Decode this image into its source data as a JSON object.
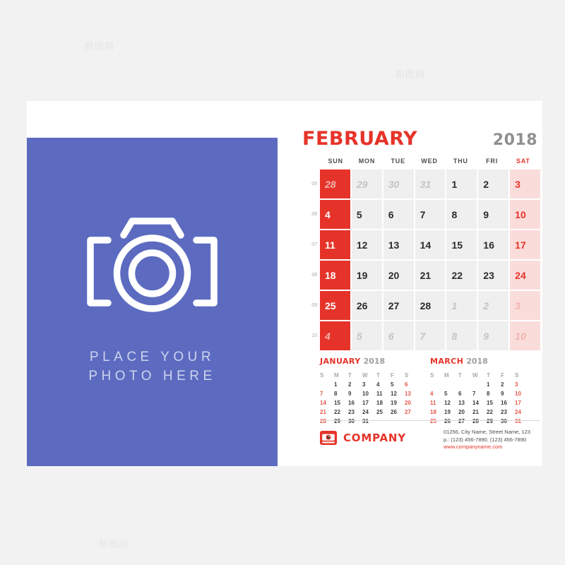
{
  "background_color": "#f2f2f2",
  "accent_red": "#e63329",
  "photo_panel": {
    "background_color": "#5c6bc0",
    "icon": "camera-icon",
    "caption_line1": "PLACE YOUR",
    "caption_line2": "PHOTO HERE"
  },
  "header": {
    "month": "FEBRUARY",
    "year": "2018"
  },
  "weekdays": [
    "SUN",
    "MON",
    "TUE",
    "WED",
    "THU",
    "FRI",
    "SAT"
  ],
  "calendar": {
    "week_numbers": [
      "05",
      "06",
      "07",
      "08",
      "09",
      "10"
    ],
    "weeks": [
      [
        {
          "day": "28",
          "type": "sun out"
        },
        {
          "day": "29",
          "type": "out"
        },
        {
          "day": "30",
          "type": "out"
        },
        {
          "day": "31",
          "type": "out"
        },
        {
          "day": "1",
          "type": ""
        },
        {
          "day": "2",
          "type": ""
        },
        {
          "day": "3",
          "type": "sat"
        }
      ],
      [
        {
          "day": "4",
          "type": "sun"
        },
        {
          "day": "5",
          "type": ""
        },
        {
          "day": "6",
          "type": ""
        },
        {
          "day": "7",
          "type": ""
        },
        {
          "day": "8",
          "type": ""
        },
        {
          "day": "9",
          "type": ""
        },
        {
          "day": "10",
          "type": "sat"
        }
      ],
      [
        {
          "day": "11",
          "type": "sun"
        },
        {
          "day": "12",
          "type": ""
        },
        {
          "day": "13",
          "type": ""
        },
        {
          "day": "14",
          "type": ""
        },
        {
          "day": "15",
          "type": ""
        },
        {
          "day": "16",
          "type": ""
        },
        {
          "day": "17",
          "type": "sat"
        }
      ],
      [
        {
          "day": "18",
          "type": "sun"
        },
        {
          "day": "19",
          "type": ""
        },
        {
          "day": "20",
          "type": ""
        },
        {
          "day": "21",
          "type": ""
        },
        {
          "day": "22",
          "type": ""
        },
        {
          "day": "23",
          "type": ""
        },
        {
          "day": "24",
          "type": "sat"
        }
      ],
      [
        {
          "day": "25",
          "type": "sun"
        },
        {
          "day": "26",
          "type": ""
        },
        {
          "day": "27",
          "type": ""
        },
        {
          "day": "28",
          "type": ""
        },
        {
          "day": "1",
          "type": "out"
        },
        {
          "day": "2",
          "type": "out"
        },
        {
          "day": "3",
          "type": "sat out"
        }
      ],
      [
        {
          "day": "4",
          "type": "sun out"
        },
        {
          "day": "5",
          "type": "out"
        },
        {
          "day": "6",
          "type": "out"
        },
        {
          "day": "7",
          "type": "out"
        },
        {
          "day": "8",
          "type": "out"
        },
        {
          "day": "9",
          "type": "out"
        },
        {
          "day": "10",
          "type": "sat out"
        }
      ]
    ]
  },
  "mini_calendars": [
    {
      "month": "JANUARY",
      "year": "2018",
      "headers": [
        "S",
        "M",
        "T",
        "W",
        "T",
        "F",
        "S"
      ],
      "cells": [
        {
          "day": "",
          "red": false
        },
        {
          "day": "1",
          "red": false
        },
        {
          "day": "2",
          "red": false
        },
        {
          "day": "3",
          "red": false
        },
        {
          "day": "4",
          "red": false
        },
        {
          "day": "5",
          "red": false
        },
        {
          "day": "6",
          "red": true
        },
        {
          "day": "7",
          "red": true
        },
        {
          "day": "8",
          "red": false
        },
        {
          "day": "9",
          "red": false
        },
        {
          "day": "10",
          "red": false
        },
        {
          "day": "11",
          "red": false
        },
        {
          "day": "12",
          "red": false
        },
        {
          "day": "13",
          "red": true
        },
        {
          "day": "14",
          "red": true
        },
        {
          "day": "15",
          "red": false
        },
        {
          "day": "16",
          "red": false
        },
        {
          "day": "17",
          "red": false
        },
        {
          "day": "18",
          "red": false
        },
        {
          "day": "19",
          "red": false
        },
        {
          "day": "20",
          "red": true
        },
        {
          "day": "21",
          "red": true
        },
        {
          "day": "22",
          "red": false
        },
        {
          "day": "23",
          "red": false
        },
        {
          "day": "24",
          "red": false
        },
        {
          "day": "25",
          "red": false
        },
        {
          "day": "26",
          "red": false
        },
        {
          "day": "27",
          "red": true
        },
        {
          "day": "28",
          "red": true
        },
        {
          "day": "29",
          "red": false
        },
        {
          "day": "30",
          "red": false
        },
        {
          "day": "31",
          "red": false
        },
        {
          "day": "",
          "red": false
        },
        {
          "day": "",
          "red": false
        },
        {
          "day": "",
          "red": false
        }
      ]
    },
    {
      "month": "MARCH",
      "year": "2018",
      "headers": [
        "S",
        "M",
        "T",
        "W",
        "T",
        "F",
        "S"
      ],
      "cells": [
        {
          "day": "",
          "red": false
        },
        {
          "day": "",
          "red": false
        },
        {
          "day": "",
          "red": false
        },
        {
          "day": "",
          "red": false
        },
        {
          "day": "1",
          "red": false
        },
        {
          "day": "2",
          "red": false
        },
        {
          "day": "3",
          "red": true
        },
        {
          "day": "4",
          "red": true
        },
        {
          "day": "5",
          "red": false
        },
        {
          "day": "6",
          "red": false
        },
        {
          "day": "7",
          "red": false
        },
        {
          "day": "8",
          "red": false
        },
        {
          "day": "9",
          "red": false
        },
        {
          "day": "10",
          "red": true
        },
        {
          "day": "11",
          "red": true
        },
        {
          "day": "12",
          "red": false
        },
        {
          "day": "13",
          "red": false
        },
        {
          "day": "14",
          "red": false
        },
        {
          "day": "15",
          "red": false
        },
        {
          "day": "16",
          "red": false
        },
        {
          "day": "17",
          "red": true
        },
        {
          "day": "18",
          "red": true
        },
        {
          "day": "19",
          "red": false
        },
        {
          "day": "20",
          "red": false
        },
        {
          "day": "21",
          "red": false
        },
        {
          "day": "22",
          "red": false
        },
        {
          "day": "23",
          "red": false
        },
        {
          "day": "24",
          "red": true
        },
        {
          "day": "25",
          "red": true
        },
        {
          "day": "26",
          "red": false
        },
        {
          "day": "27",
          "red": false
        },
        {
          "day": "28",
          "red": false
        },
        {
          "day": "29",
          "red": false
        },
        {
          "day": "30",
          "red": false
        },
        {
          "day": "31",
          "red": true
        }
      ]
    }
  ],
  "footer": {
    "logo_icon": "camera-logo-icon",
    "company_name": "COMPANY",
    "address": "01256, City Name, Street Name, 123",
    "phone": "p.: (123) 456-7890, (123) 456-7890",
    "website": "www.companyname.com"
  },
  "watermarks": [
    "新图网",
    "新图网",
    "新图网",
    "新图网",
    "新图网",
    "新图网",
    "新图网",
    "新图网"
  ]
}
